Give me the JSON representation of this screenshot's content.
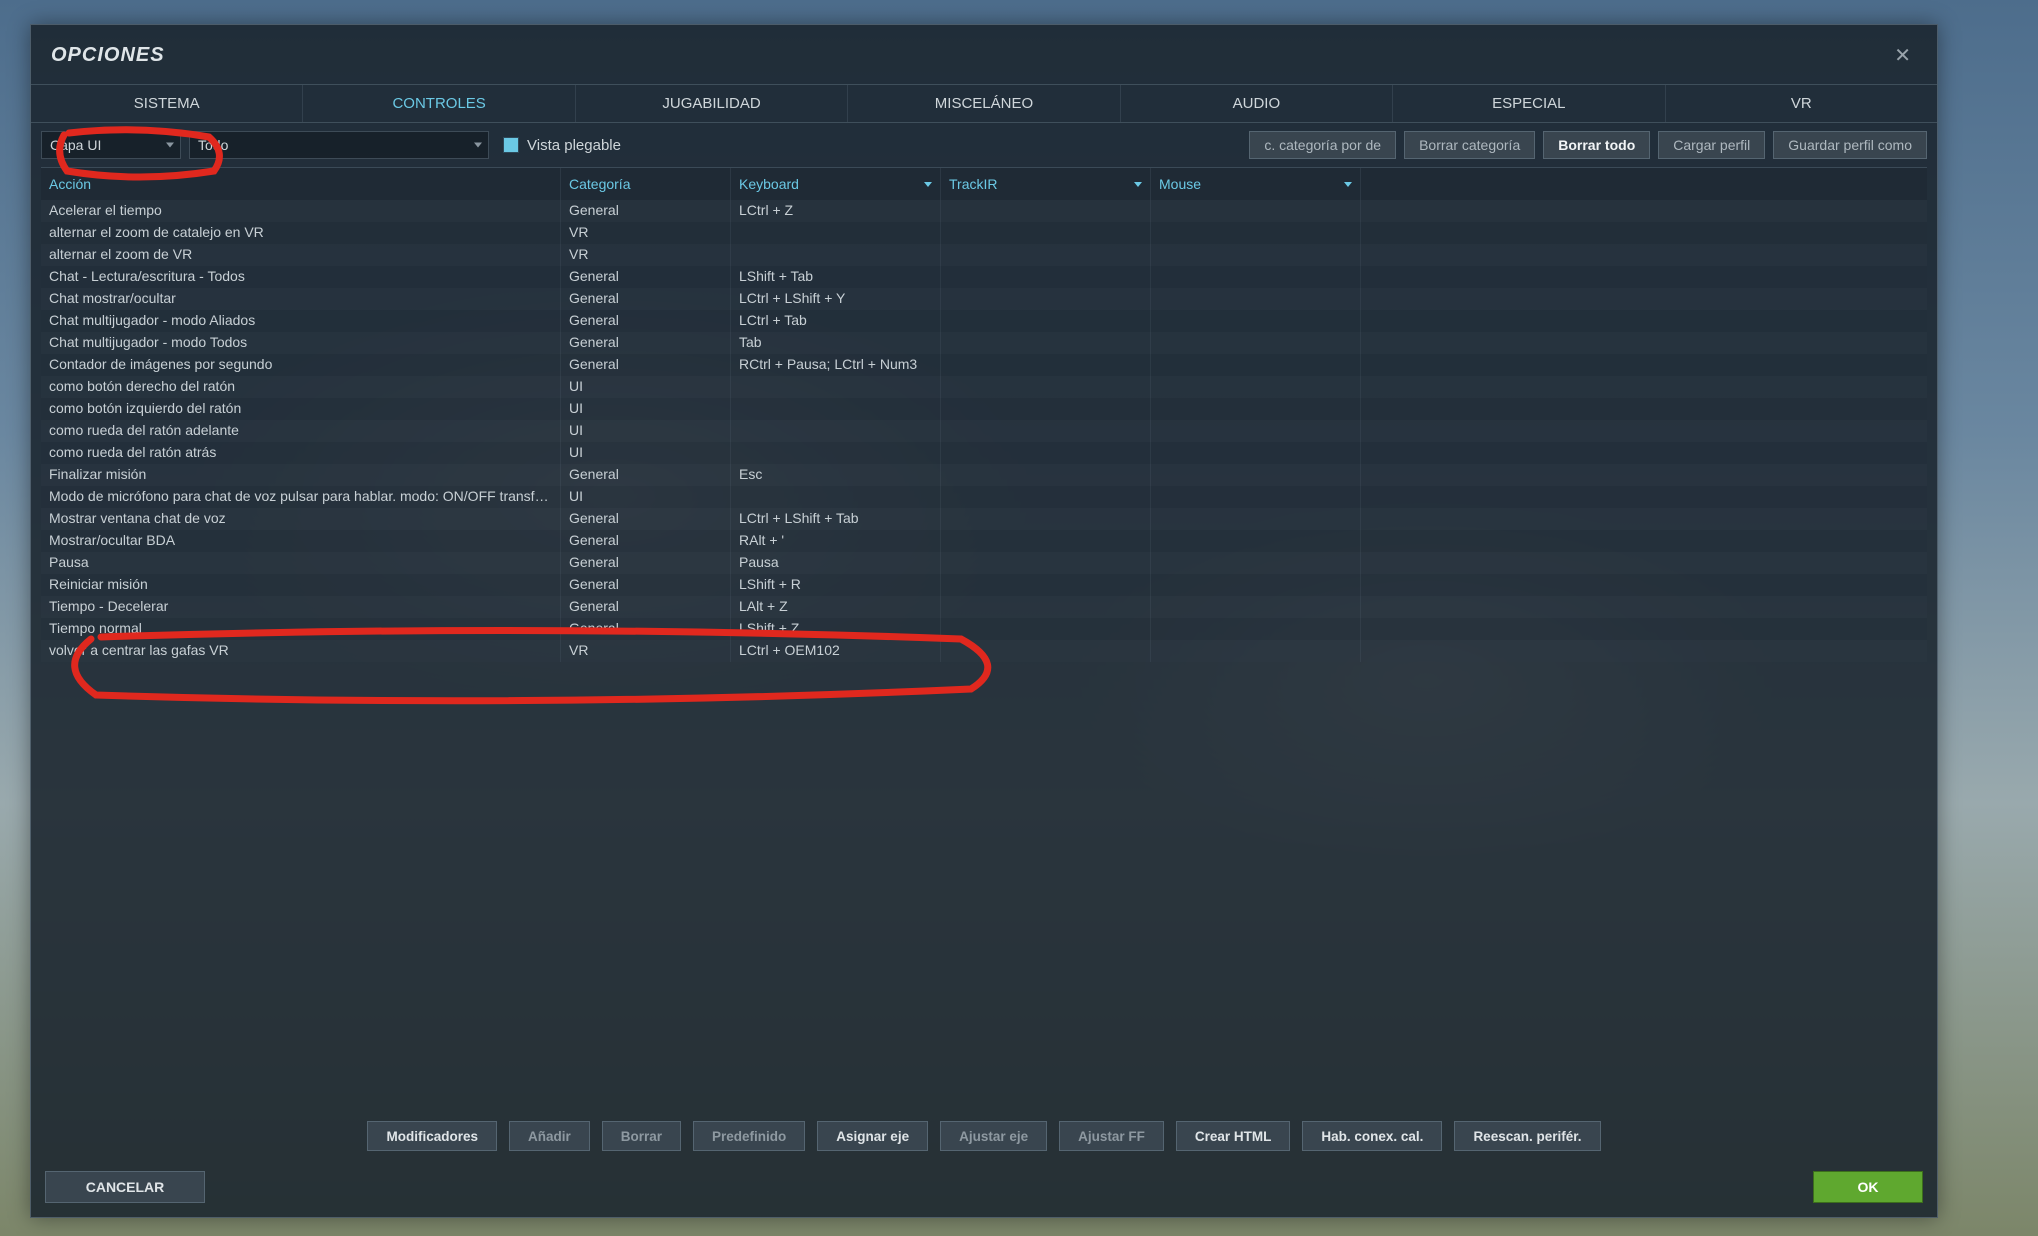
{
  "window": {
    "title": "OPCIONES"
  },
  "tabs": {
    "items": [
      "SISTEMA",
      "CONTROLES",
      "JUGABILIDAD",
      "MISCELÁNEO",
      "AUDIO",
      "ESPECIAL",
      "VR"
    ],
    "active_index": 1
  },
  "toolbar": {
    "layer_select": "Capa UI",
    "filter_select": "Todo",
    "foldable_label": "Vista plegable",
    "btn_cat_default": "c. categoría por de",
    "btn_clear_cat": "Borrar categoría",
    "btn_clear_all": "Borrar todo",
    "btn_load_profile": "Cargar perfil",
    "btn_save_profile_as": "Guardar perfil como"
  },
  "columns": {
    "action": "Acción",
    "category": "Categoría",
    "device1": "Keyboard",
    "device2": "TrackIR",
    "device3": "Mouse"
  },
  "rows": [
    {
      "action": "Acelerar el tiempo",
      "category": "General",
      "keyboard": "LCtrl + Z"
    },
    {
      "action": "alternar el zoom de catalejo en VR",
      "category": "VR",
      "keyboard": ""
    },
    {
      "action": "alternar el zoom de VR",
      "category": "VR",
      "keyboard": ""
    },
    {
      "action": "Chat - Lectura/escritura - Todos",
      "category": "General",
      "keyboard": "LShift + Tab"
    },
    {
      "action": "Chat mostrar/ocultar",
      "category": "General",
      "keyboard": "LCtrl + LShift + Y"
    },
    {
      "action": "Chat multijugador - modo Aliados",
      "category": "General",
      "keyboard": "LCtrl + Tab"
    },
    {
      "action": "Chat multijugador - modo Todos",
      "category": "General",
      "keyboard": "Tab"
    },
    {
      "action": "Contador de imágenes por segundo",
      "category": "General",
      "keyboard": "RCtrl + Pausa; LCtrl + Num3"
    },
    {
      "action": "como botón derecho del ratón",
      "category": "UI",
      "keyboard": ""
    },
    {
      "action": "como botón izquierdo del ratón",
      "category": "UI",
      "keyboard": ""
    },
    {
      "action": "como rueda del ratón adelante",
      "category": "UI",
      "keyboard": ""
    },
    {
      "action": "como rueda del ratón atrás",
      "category": "UI",
      "keyboard": ""
    },
    {
      "action": "Finalizar misión",
      "category": "General",
      "keyboard": "Esc"
    },
    {
      "action": "Modo de micrófono para chat de voz pulsar para hablar. modo: ON/OFF transferenc",
      "category": "UI",
      "keyboard": ""
    },
    {
      "action": "Mostrar ventana chat de voz",
      "category": "General",
      "keyboard": "LCtrl + LShift + Tab"
    },
    {
      "action": "Mostrar/ocultar BDA",
      "category": "General",
      "keyboard": "RAlt + '"
    },
    {
      "action": "Pausa",
      "category": "General",
      "keyboard": "Pausa"
    },
    {
      "action": "Reiniciar misión",
      "category": "General",
      "keyboard": "LShift + R"
    },
    {
      "action": "Tiempo - Decelerar",
      "category": "General",
      "keyboard": "LAlt + Z"
    },
    {
      "action": "Tiempo normal",
      "category": "General",
      "keyboard": "LShift + Z"
    },
    {
      "action": "volver a centrar las gafas VR",
      "category": "VR",
      "keyboard": "LCtrl + OEM102"
    }
  ],
  "bottom": {
    "modifiers": "Modificadores",
    "add": "Añadir",
    "delete": "Borrar",
    "default": "Predefinido",
    "assign_axis": "Asignar eje",
    "adjust_axis": "Ajustar eje",
    "adjust_ff": "Ajustar FF",
    "make_html": "Crear HTML",
    "enable_hot_cal": "Hab. conex. cal.",
    "rescan": "Reescan. perifér."
  },
  "footer": {
    "cancel": "CANCELAR",
    "ok": "OK"
  }
}
